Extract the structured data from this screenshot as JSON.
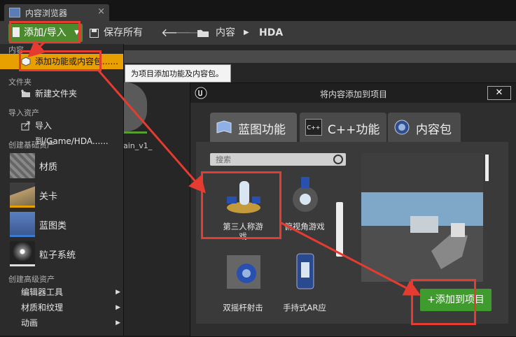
{
  "window": {
    "tab_title": "内容浏览器",
    "close_glyph": "×"
  },
  "toolbar": {
    "add_import_label": "添加/导入",
    "save_all_label": "保存所有",
    "breadcrumb": [
      "内容",
      "HDA"
    ]
  },
  "menu": {
    "content_header": "内容",
    "add_feature_label": "添加功能或内容包......",
    "folder_header": "文件夹",
    "new_folder_label": "新建文件夹",
    "import_header": "导入资产",
    "import_label": "导入到/Game/HDA......",
    "basic_header": "创建基础资产",
    "basic_items": [
      "材质",
      "关卡",
      "蓝图类",
      "粒子系统"
    ],
    "advanced_header": "创建高级资产",
    "advanced_items": [
      "编辑器工具",
      "材质和纹理",
      "动画"
    ]
  },
  "background": {
    "asset_name_fragment": "ain_v1_"
  },
  "tooltip": {
    "text": "为项目添加功能及内容包。"
  },
  "dialog": {
    "title": "将内容添加到项目",
    "close_glyph": "✕",
    "tabs": [
      "蓝图功能",
      "C++功能",
      "内容包"
    ],
    "cpp_badge": "C++",
    "search_placeholder": "搜索",
    "templates": [
      {
        "label_line1": "第三人称游",
        "label_line2": "戏"
      },
      {
        "label_line1": "俯视角游戏",
        "label_line2": ""
      },
      {
        "label_line1": "双摇杆射击",
        "label_line2": ""
      },
      {
        "label_line1": "手持式AR应",
        "label_line2": ""
      }
    ],
    "add_to_project_label": "添加到项目",
    "plus_glyph": "+"
  },
  "colors": {
    "annotation_red": "#e53b30",
    "accent_green": "#4c8a2e",
    "menu_highlight": "#e8a000"
  }
}
